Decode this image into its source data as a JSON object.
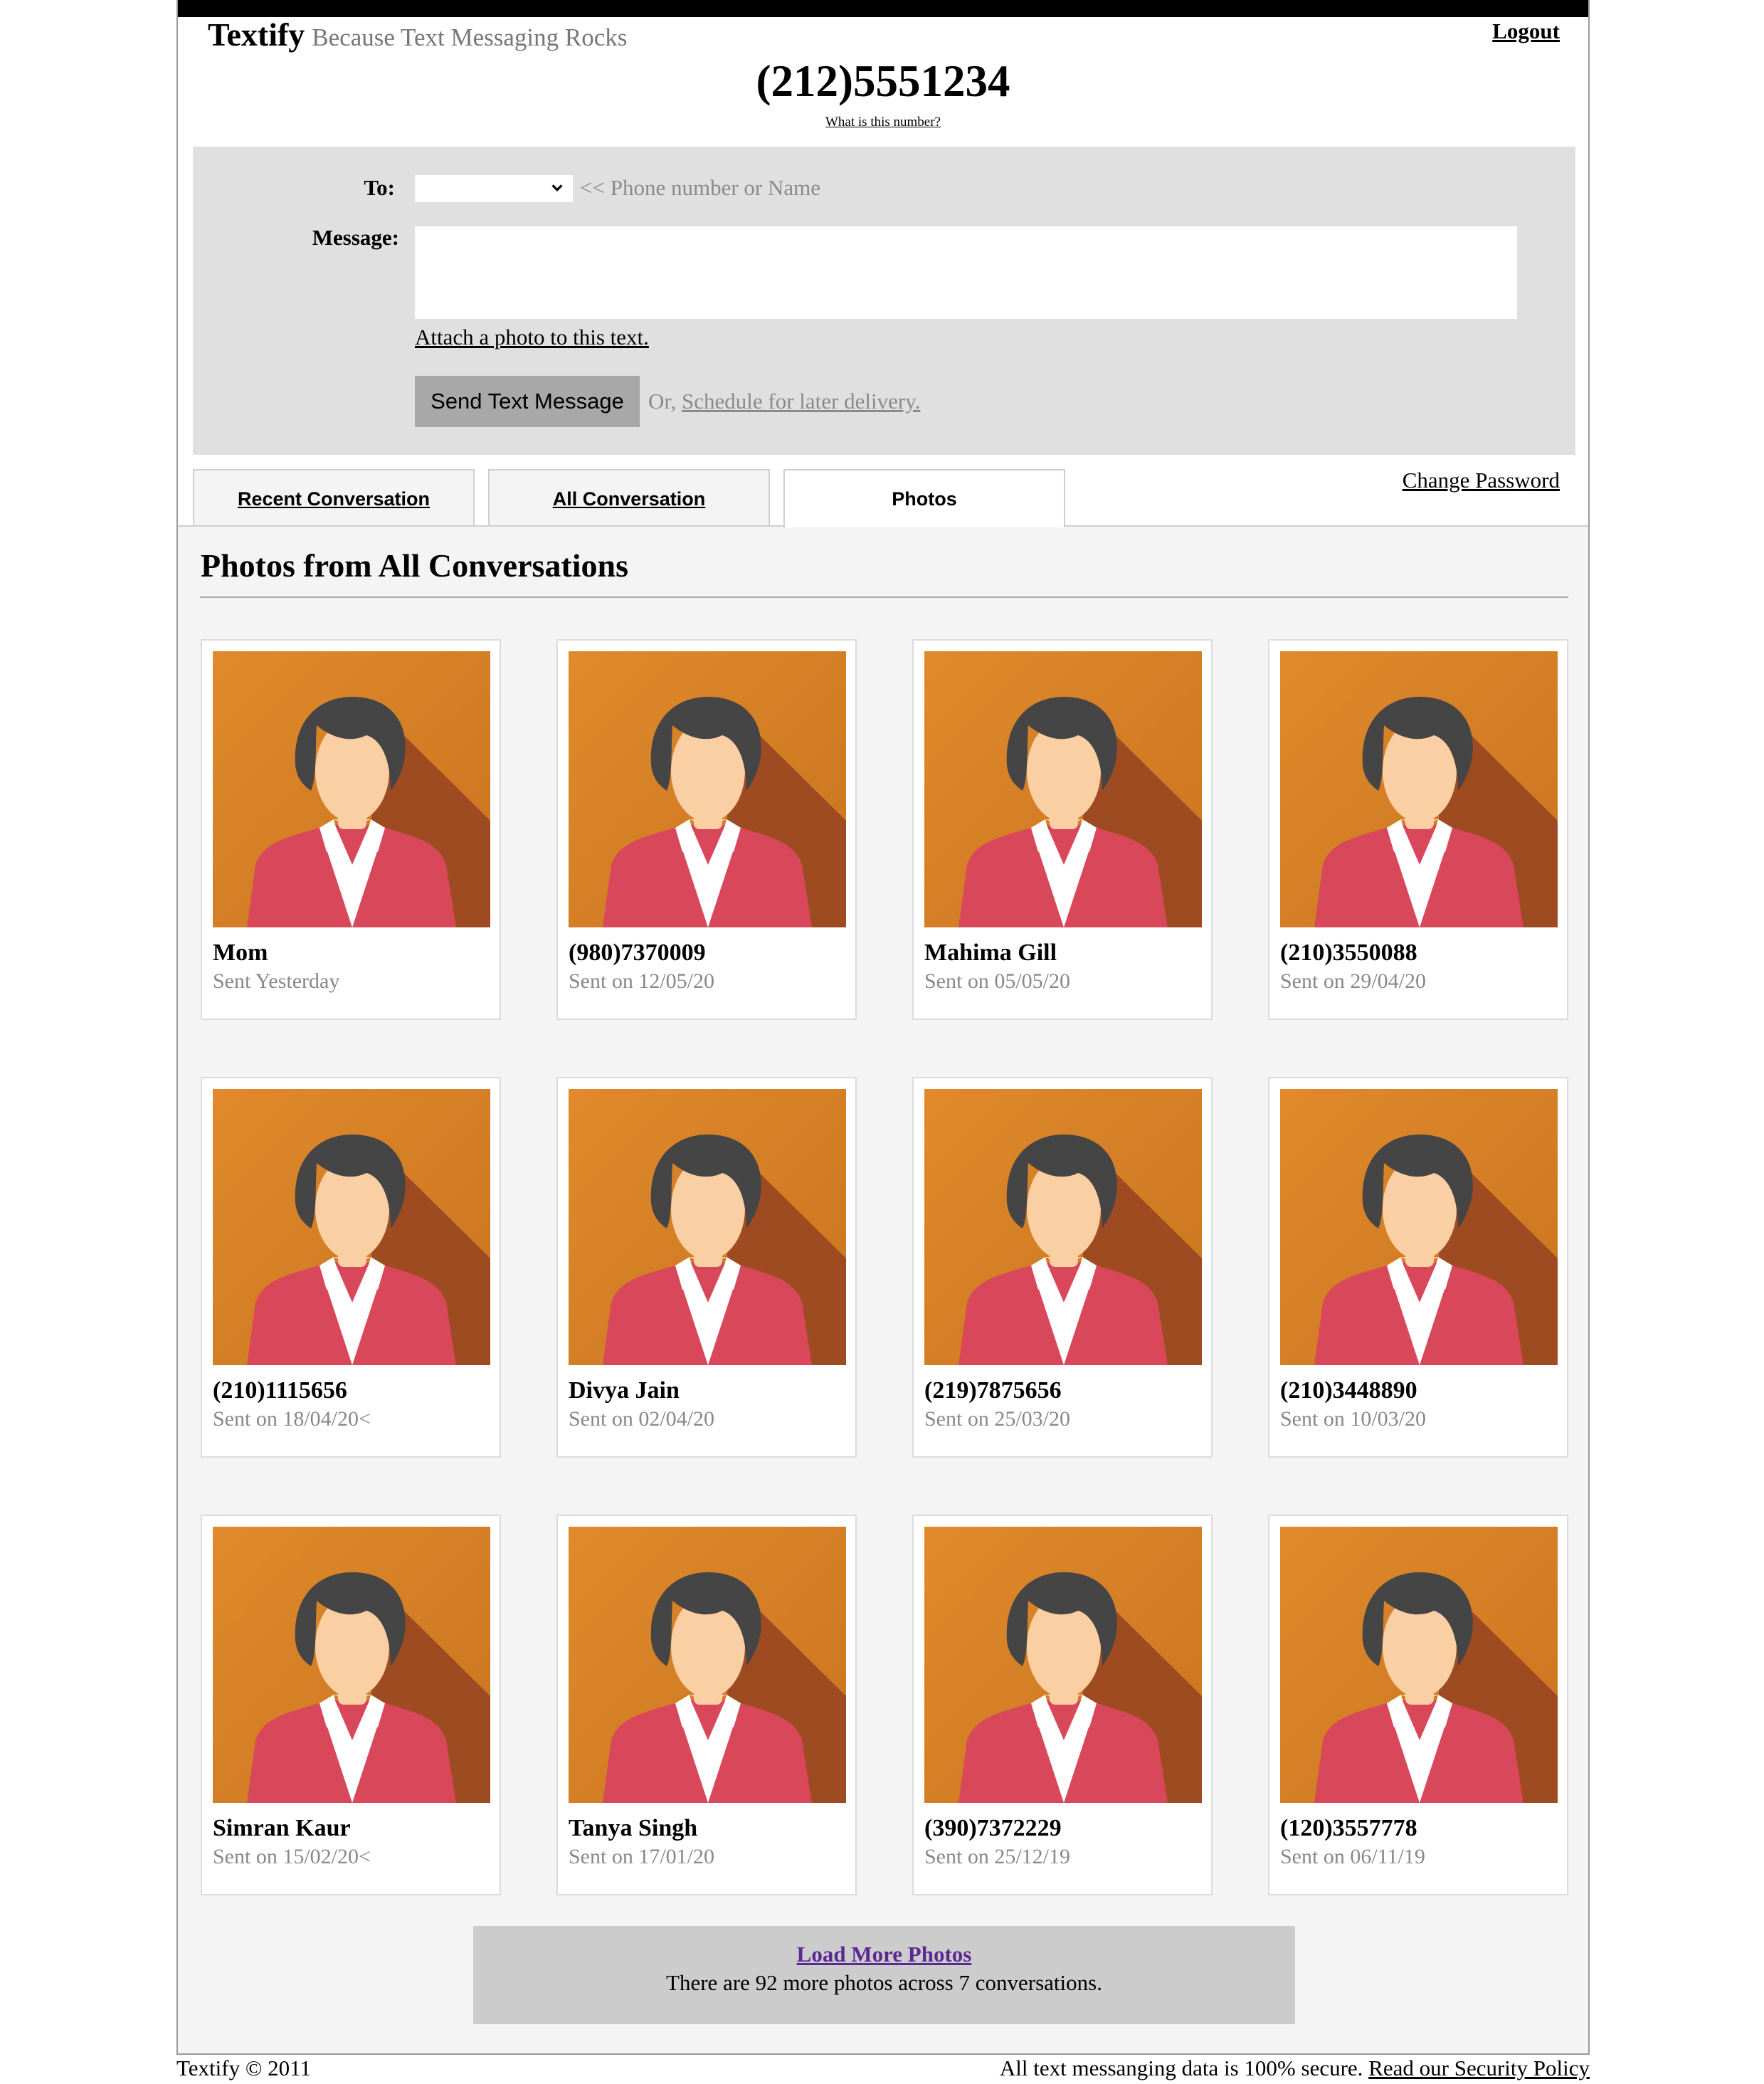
{
  "brand": {
    "name": "Textify",
    "tagline": "Because Text Messaging Rocks"
  },
  "header": {
    "logout": "Logout",
    "phone_number": "(212)5551234",
    "what_is_number": "What is this number?"
  },
  "compose": {
    "to_label": "To:",
    "to_hint": "<< Phone number or Name",
    "to_selected": "",
    "message_label": "Message:",
    "message_value": "",
    "attach_link": "Attach a photo to this text.",
    "send_button": "Send Text Message",
    "schedule_prefix": "Or, ",
    "schedule_link": "Schedule for later delivery."
  },
  "tabs": [
    {
      "label": "Recent Conversation"
    },
    {
      "label": "All Conversation"
    },
    {
      "label": "Photos"
    }
  ],
  "active_tab": "Photos",
  "change_password": "Change Password",
  "section": {
    "title": "Photos from All Conversations"
  },
  "photos": [
    {
      "name": "Mom",
      "sent": "Sent Yesterday"
    },
    {
      "name": "(980)7370009",
      "sent": "Sent on 12/05/20"
    },
    {
      "name": "Mahima Gill",
      "sent": "Sent on 05/05/20"
    },
    {
      "name": "(210)3550088",
      "sent": "Sent on 29/04/20"
    },
    {
      "name": "(210)1115656",
      "sent": "Sent on 18/04/20<"
    },
    {
      "name": "Divya Jain",
      "sent": "Sent on 02/04/20"
    },
    {
      "name": "(219)7875656",
      "sent": "Sent on 25/03/20"
    },
    {
      "name": "(210)3448890",
      "sent": "Sent on 10/03/20"
    },
    {
      "name": "Simran Kaur",
      "sent": "Sent on 15/02/20<"
    },
    {
      "name": "Tanya Singh",
      "sent": "Sent on 17/01/20"
    },
    {
      "name": "(390)7372229",
      "sent": "Sent on 25/12/19"
    },
    {
      "name": "(120)3557778",
      "sent": "Sent on 06/11/19"
    }
  ],
  "load_more": {
    "link": "Load More Photos",
    "note": "There are 92 more photos across 7 conversations."
  },
  "footer": {
    "copyright": "Textify © 2011",
    "security_note": "All text messanging data is 100% secure. ",
    "security_link": "Read our Security Policy"
  },
  "colors": {
    "avatar_bg": "#e08a2c",
    "avatar_shadow": "#9f4b22",
    "avatar_hair": "#454545",
    "avatar_skin": "#fbcfa4",
    "avatar_jacket": "#d9475a",
    "link_visited": "#5a2a92",
    "compose_bg": "#e0e0e0"
  },
  "icons": {
    "photo": "female-avatar-icon",
    "select": "chevron-down-icon"
  }
}
